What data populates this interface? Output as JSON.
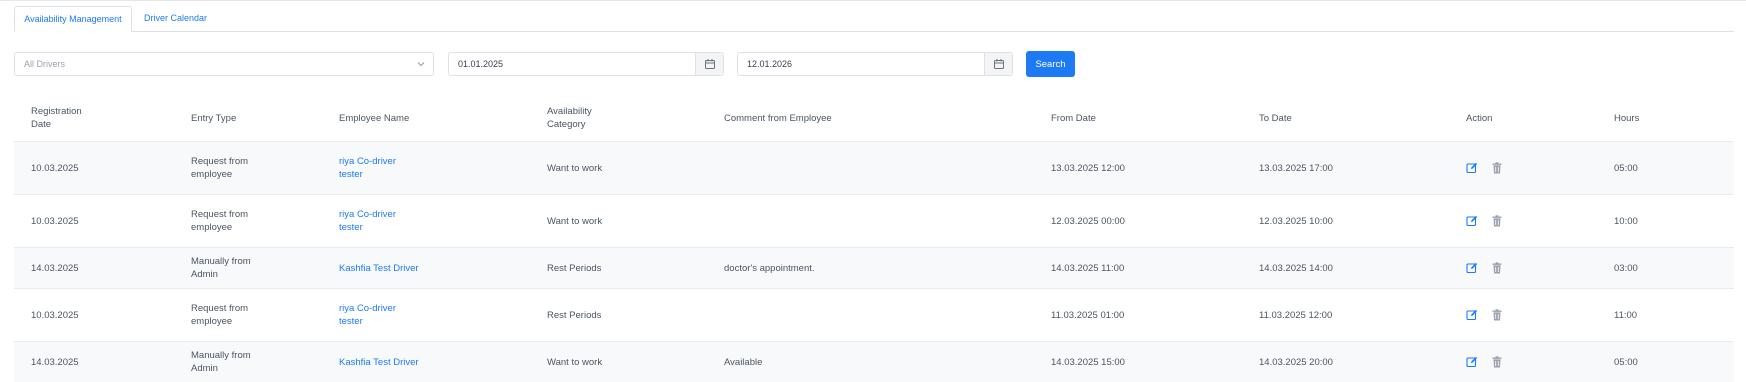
{
  "tabs": {
    "active": "Availability Management",
    "second": "Driver Calendar"
  },
  "filters": {
    "driver_select": "All Drivers",
    "from_date": "01.01.2025",
    "to_date": "12.01.2026",
    "search_label": "Search"
  },
  "table": {
    "headers": [
      "Registration Date",
      "Entry Type",
      "Employee Name",
      "Availability Category",
      "Comment from Employee",
      "From Date",
      "To Date",
      "Action",
      "Hours"
    ],
    "rows": [
      {
        "registration": "10.03.2025",
        "entry_type": "Request from employee",
        "employee": "riya Co-driver tester",
        "category": "Want to work",
        "comment": "",
        "from": "13.03.2025 12:00",
        "to": "13.03.2025 17:00",
        "hours": "05:00"
      },
      {
        "registration": "10.03.2025",
        "entry_type": "Request from employee",
        "employee": "riya Co-driver tester",
        "category": "Want to work",
        "comment": "",
        "from": "12.03.2025 00:00",
        "to": "12.03.2025 10:00",
        "hours": "10:00"
      },
      {
        "registration": "14.03.2025",
        "entry_type": "Manually from Admin",
        "employee": "Kashfia Test Driver",
        "category": "Rest Periods",
        "comment": "doctor's appointment.",
        "from": "14.03.2025 11:00",
        "to": "14.03.2025 14:00",
        "hours": "03:00"
      },
      {
        "registration": "10.03.2025",
        "entry_type": "Request from employee",
        "employee": "riya Co-driver tester",
        "category": "Rest Periods",
        "comment": "",
        "from": "11.03.2025 01:00",
        "to": "11.03.2025 12:00",
        "hours": "11:00"
      },
      {
        "registration": "14.03.2025",
        "entry_type": "Manually from Admin",
        "employee": "Kashfia Test Driver",
        "category": "Want to work",
        "comment": "Available",
        "from": "14.03.2025 15:00",
        "to": "14.03.2025 20:00",
        "hours": "05:00"
      }
    ]
  },
  "icons": {
    "edit": "edit-icon",
    "delete": "trash-icon",
    "calendar": "calendar-icon",
    "dropdown": "chevron-down-icon"
  },
  "colors": {
    "accent": "#1d7af3",
    "row_stripe": "#f8f9fa"
  }
}
